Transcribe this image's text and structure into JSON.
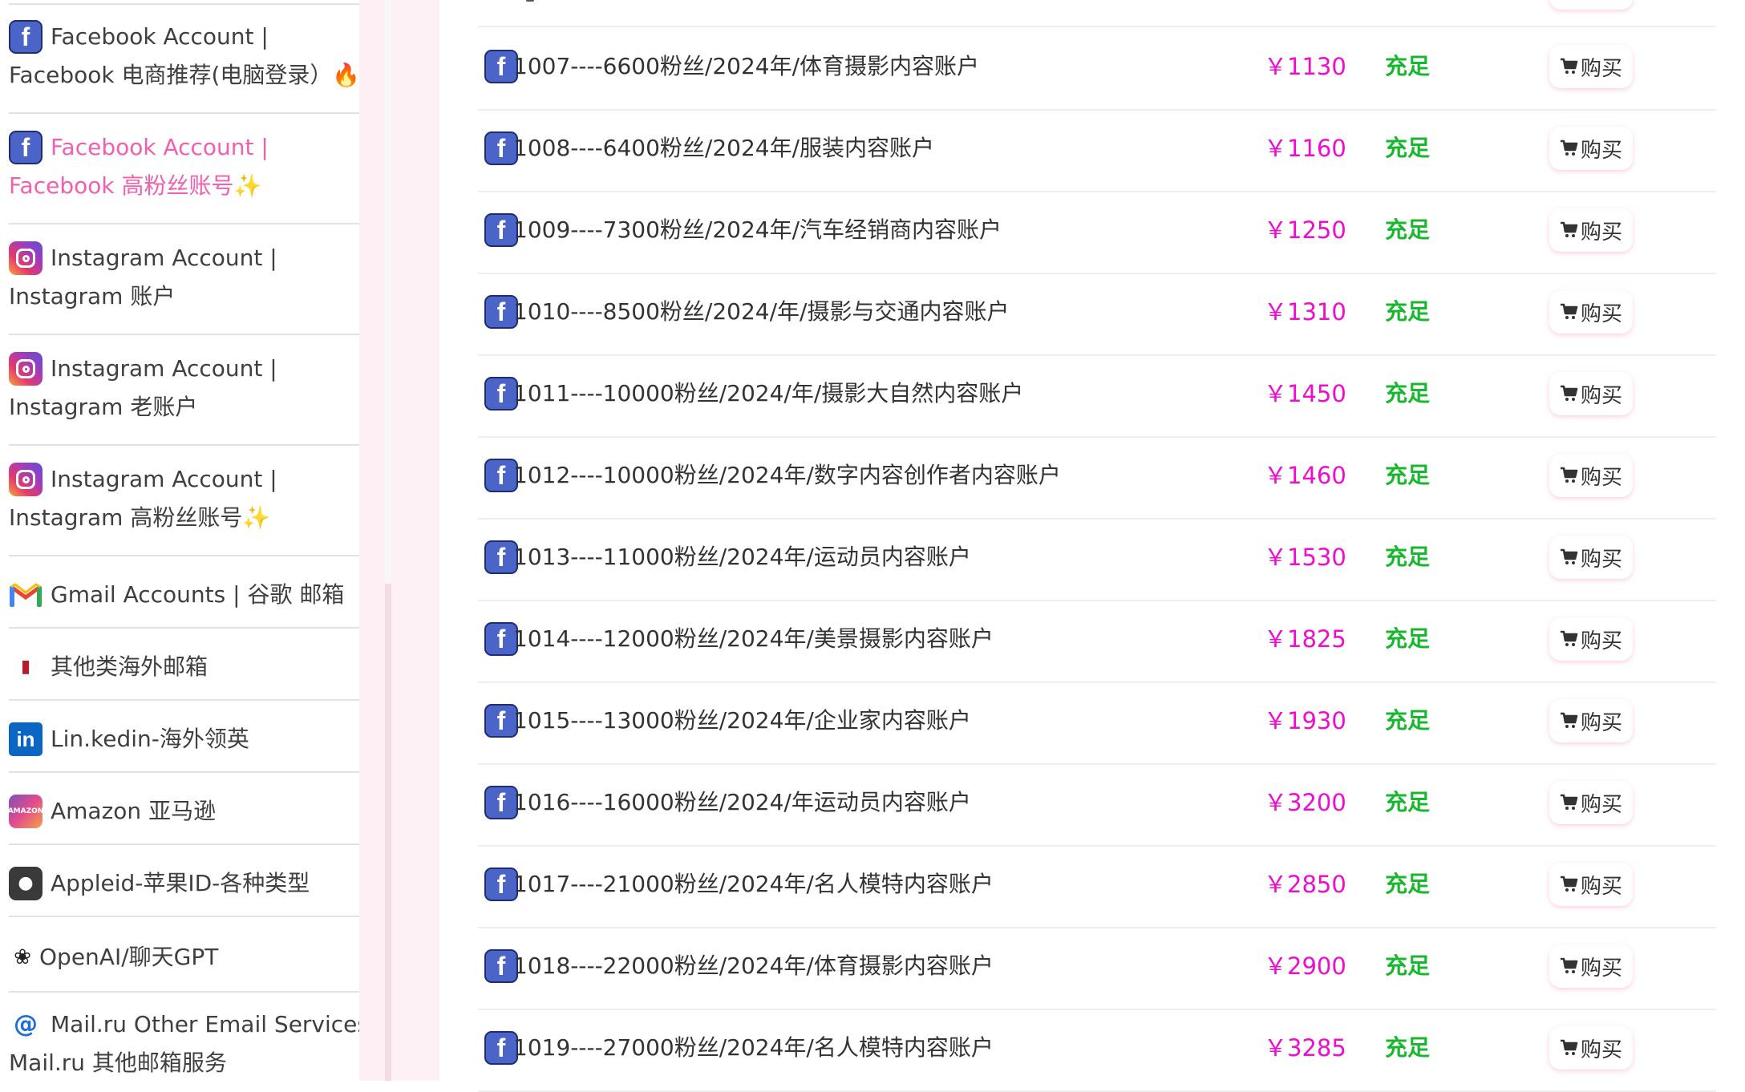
{
  "sidebar": {
    "items": [
      {
        "icon": "facebook-icon",
        "line1": "Facebook Account |",
        "line2": "Facebook 电商推荐(电脑登录）🔥",
        "active": false
      },
      {
        "icon": "facebook-icon",
        "line1": "Facebook Account |",
        "line2": "Facebook 高粉丝账号✨",
        "active": true
      },
      {
        "icon": "instagram-icon",
        "line1": "Instagram Account |",
        "line2": "Instagram 账户",
        "active": false
      },
      {
        "icon": "instagram-icon",
        "line1": "Instagram Account |",
        "line2": "Instagram 老账户",
        "active": false
      },
      {
        "icon": "instagram-icon",
        "line1": "Instagram Account |",
        "line2": "Instagram 高粉丝账号✨",
        "active": false
      },
      {
        "icon": "gmail-icon",
        "line1": "Gmail Accounts | 谷歌 邮箱",
        "active": false
      },
      {
        "icon": "mailbox-icon",
        "line1": "其他类海外邮箱",
        "active": false
      },
      {
        "icon": "linkedin-icon",
        "line1": "Lin.kedin-海外领英",
        "active": false
      },
      {
        "icon": "amazon-icon",
        "line1": "Amazon 亚马逊",
        "active": false
      },
      {
        "icon": "apple-icon",
        "line1": "Appleid-苹果ID-各种类型",
        "active": false
      },
      {
        "icon": "chatgpt-icon",
        "line1": "OpenAI/聊天GPT",
        "active": false
      },
      {
        "icon": "at-mail-icon",
        "line1": "Mail.ru Other Email Services |",
        "line2": "Mail.ru 其他邮箱服务",
        "active": false
      }
    ]
  },
  "products": [
    {
      "title": "1007----6600粉丝/2024年/体育摄影内容账户",
      "price": "￥1130",
      "stock": "充足",
      "buy": "购买"
    },
    {
      "title": "1008----6400粉丝/2024年/服装内容账户",
      "price": "￥1160",
      "stock": "充足",
      "buy": "购买"
    },
    {
      "title": "1009----7300粉丝/2024年/汽车经销商内容账户",
      "price": "￥1250",
      "stock": "充足",
      "buy": "购买"
    },
    {
      "title": "1010----8500粉丝/2024/年/摄影与交通内容账户",
      "price": "￥1310",
      "stock": "充足",
      "buy": "购买"
    },
    {
      "title": "1011----10000粉丝/2024/年/摄影大自然内容账户",
      "price": "￥1450",
      "stock": "充足",
      "buy": "购买"
    },
    {
      "title": "1012----10000粉丝/2024年/数字内容创作者内容账户",
      "price": "￥1460",
      "stock": "充足",
      "buy": "购买"
    },
    {
      "title": "1013----11000粉丝/2024年/运动员内容账户",
      "price": "￥1530",
      "stock": "充足",
      "buy": "购买"
    },
    {
      "title": "1014----12000粉丝/2024年/美景摄影内容账户",
      "price": "￥1825",
      "stock": "充足",
      "buy": "购买"
    },
    {
      "title": "1015----13000粉丝/2024年/企业家内容账户",
      "price": "￥1930",
      "stock": "充足",
      "buy": "购买"
    },
    {
      "title": "1016----16000粉丝/2024/年运动员内容账户",
      "price": "￥3200",
      "stock": "充足",
      "buy": "购买"
    },
    {
      "title": "1017----21000粉丝/2024年/名人模特内容账户",
      "price": "￥2850",
      "stock": "充足",
      "buy": "购买"
    },
    {
      "title": "1018----22000粉丝/2024年/体育摄影内容账户",
      "price": "￥2900",
      "stock": "充足",
      "buy": "购买"
    },
    {
      "title": "1019----27000粉丝/2024年/名人模特内容账户",
      "price": "￥3285",
      "stock": "充足",
      "buy": "购买"
    }
  ],
  "colors": {
    "accent_pink": "#f25fae",
    "price_magenta": "#ef0ccf",
    "stock_green": "#18b82e",
    "facebook_blue": "#4a64c8"
  }
}
